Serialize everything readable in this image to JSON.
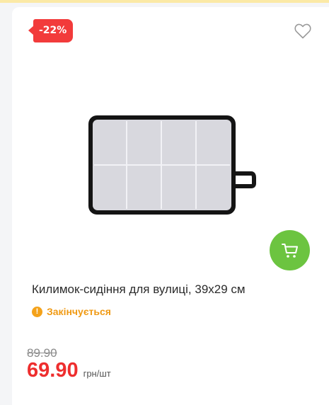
{
  "product": {
    "discount_badge": "-22%",
    "title": "Килимок-сидіння для вулиці, 39х29 см",
    "stock_status": "Закінчується",
    "old_price": "89.90",
    "price": "69.90",
    "unit": "грн/шт"
  },
  "icons": {
    "favorite": "heart-outline-icon",
    "cart": "shopping-cart-icon",
    "stock": "exclamation-icon"
  },
  "colors": {
    "badge": "#f23b3b",
    "cart_button": "#6cc440",
    "price": "#ee2e2e",
    "stock": "#f09a14"
  }
}
